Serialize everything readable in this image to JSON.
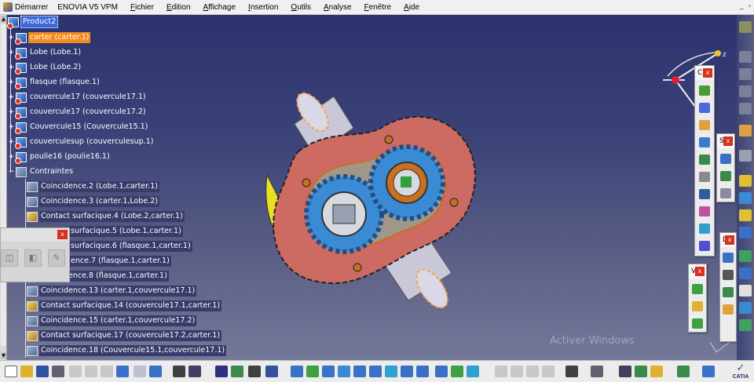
{
  "menubar": {
    "start": "Démarrer",
    "product": "ENOVIA V5 VPM",
    "menus": [
      "Fichier",
      "Edition",
      "Affichage",
      "Insertion",
      "Outils",
      "Analyse",
      "Fenêtre",
      "Aide"
    ]
  },
  "tree": {
    "root": "Product2",
    "parts": [
      "carter (carter.1)",
      "Lobe (Lobe.1)",
      "Lobe (Lobe.2)",
      "flasque (flasque.1)",
      "couvercule17 (couvercule17.1)",
      "couvercule17 (couvercule17.2)",
      "Couvercule15 (Couvercule15.1)",
      "couverculesup (couverculesup.1)",
      "poulie16 (poulie16.1)"
    ],
    "constraints_node": "Contraintes",
    "constraints": [
      "Coincidence.2 (Lobe.1,carter.1)",
      "Coincidence.3 (carter.1,Lobe.2)",
      "Contact surfacique.4 (Lobe.2,carter.1)",
      "surfacique.5 (Lobe.1,carter.1)",
      "surfacique.6 (flasque.1,carter.1)",
      "ence.7 (flasque.1,carter.1)",
      "Coincidence.8 (flasque.1,carter.1)",
      "Coincidence.13 (carter.1,couvercule17.1)",
      "Contact surfacique.14 (couvercule17.1,carter.1)",
      "Coincidence.15 (carter.1,couvercule17.2)",
      "Contact surfacique.17 (couvercule17.2,carter.1)",
      "Coincidence.18 (Couvercule15.1,couvercule17.1)"
    ]
  },
  "panels": {
    "panel1": "C",
    "panel2": "S",
    "panel3": "D",
    "panel4": "V"
  },
  "close_glyph": "x",
  "compass_axis": "z",
  "small_axis": "z",
  "brand": "CATIA",
  "colors": {
    "selection": "#3d66d8",
    "highlight": "#f28a1c",
    "carter": "#cd6a62",
    "gears": "#3a8ad4",
    "close_button": "#d93020"
  }
}
